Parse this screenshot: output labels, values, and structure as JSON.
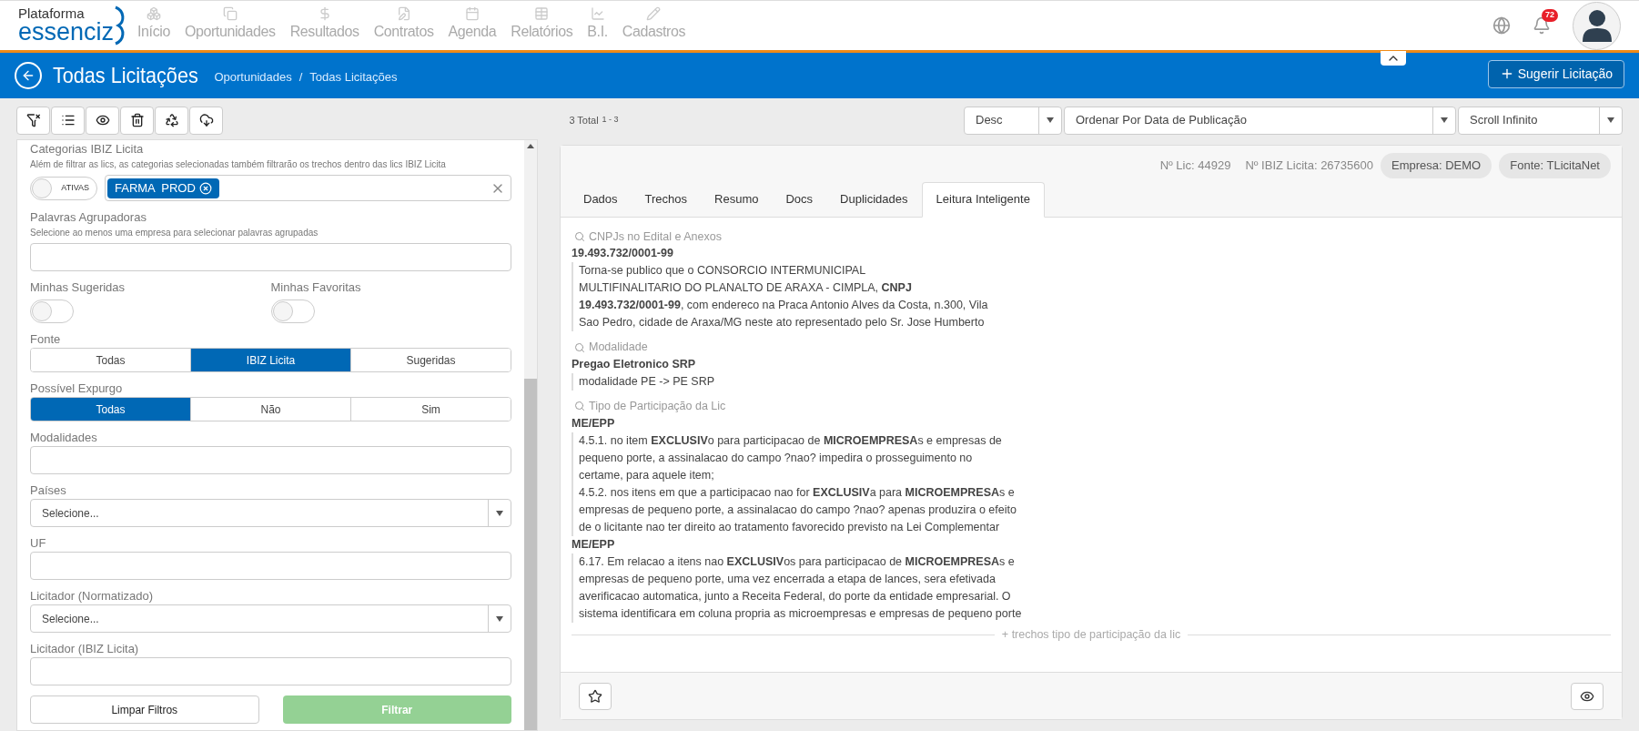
{
  "brand": {
    "line1": "Plataforma",
    "line2": "essenciz"
  },
  "nav": [
    {
      "label": "Início"
    },
    {
      "label": "Oportunidades"
    },
    {
      "label": "Resultados"
    },
    {
      "label": "Contratos"
    },
    {
      "label": "Agenda"
    },
    {
      "label": "Relatórios"
    },
    {
      "label": "B.I."
    },
    {
      "label": "Cadastros"
    }
  ],
  "notifications": {
    "count": "72"
  },
  "page": {
    "title": "Todas Licitações",
    "breadcrumb": [
      "Oportunidades",
      "Todas Licitações"
    ],
    "breadcrumb_separator": "/",
    "action": "Sugerir Licitação"
  },
  "toolbar": {
    "total": "3 Total",
    "range": "1 - 3",
    "order": "Desc",
    "sort": "Ordenar Por Data de Publicação",
    "mode": "Scroll Infinito"
  },
  "filters": [
    {
      "kind": "chips",
      "label": "Categorias IBIZ Licita",
      "hint": "Além de filtrar as lics, as categorias selecionadas também filtrarão os trechos dentro das lics IBIZ Licita",
      "toggle_label": "ATIVAS",
      "on": false,
      "chips": [
        "FARMA  PROD"
      ]
    },
    {
      "kind": "text",
      "label": "Palavras Agrupadoras",
      "hint": "Selecione ao menos uma empresa para selecionar palavras agrupadas"
    },
    {
      "kind": "toggles",
      "items": [
        {
          "label": "Minhas Sugeridas",
          "on": false
        },
        {
          "label": "Minhas Favoritas",
          "on": false
        }
      ]
    },
    {
      "kind": "segmented",
      "label": "Fonte",
      "options": [
        {
          "label": "Todas",
          "selected": false
        },
        {
          "label": "IBIZ Licita",
          "selected": true
        },
        {
          "label": "Sugeridas",
          "selected": false
        }
      ]
    },
    {
      "kind": "segmented",
      "label": "Possível Expurgo",
      "options": [
        {
          "label": "Todas",
          "selected": true
        },
        {
          "label": "Não",
          "selected": false
        },
        {
          "label": "Sim",
          "selected": false
        }
      ]
    },
    {
      "kind": "text",
      "label": "Modalidades"
    },
    {
      "kind": "select",
      "label": "Países",
      "placeholder": "Selecione..."
    },
    {
      "kind": "text",
      "label": "UF"
    },
    {
      "kind": "select",
      "label": "Licitador (Normatizado)",
      "placeholder": "Selecione..."
    },
    {
      "kind": "text",
      "label": "Licitador (IBIZ Licita)"
    }
  ],
  "filter_buttons": {
    "clear": "Limpar Filtros",
    "apply": "Filtrar"
  },
  "detail": {
    "info": [
      "Nº Lic: 44929",
      "Nº IBIZ Licita: 26735600"
    ],
    "pills": [
      "Empresa: DEMO",
      "Fonte: TLicitaNet"
    ],
    "tabs": [
      {
        "label": "Dados",
        "selected": false
      },
      {
        "label": "Trechos",
        "selected": false
      },
      {
        "label": "Resumo",
        "selected": false
      },
      {
        "label": "Docs",
        "selected": false
      },
      {
        "label": "Duplicidades",
        "selected": false
      },
      {
        "label": "Leitura Inteligente",
        "selected": true
      }
    ],
    "sections": [
      {
        "title": "CNPJs no Edital e Anexos",
        "entries": [
          {
            "value": "19.493.732/0001-99",
            "lines": [
              "Torna-se publico que o CONSORCIO INTERMUNICIPAL",
              "MULTIFINALITARIO DO PLANALTO DE ARAXA - CIMPLA, **CNPJ**",
              "**19.493.732/0001-99**, com endereco na Praca Antonio Alves da Costa, n.300, Vila",
              "Sao Pedro, cidade de Araxa/MG neste ato representado pelo Sr. Jose Humberto"
            ]
          }
        ]
      },
      {
        "title": "Modalidade",
        "entries": [
          {
            "value": "Pregao Eletronico SRP",
            "lines": [
              "modalidade PE -> PE SRP"
            ]
          }
        ]
      },
      {
        "title": "Tipo de Participação da Lic",
        "entries": [
          {
            "value": "ME/EPP",
            "lines": [
              "4.5.1. no item **EXCLUSIV**o para participacao de **MICROEMPRESA**s e empresas de",
              "pequeno porte, a assinalacao do campo ?nao? impedira o prosseguimento no",
              "certame, para aquele item;",
              "4.5.2. nos itens em que a participacao nao for **EXCLUSIV**a para **MICROEMPRESA**s e",
              "empresas de pequeno porte, a assinalacao do campo ?nao? apenas produzira o efeito",
              "de o licitante nao ter direito ao tratamento favorecido previsto na Lei Complementar"
            ]
          },
          {
            "value": "ME/EPP",
            "lines": [
              "6.17. Em relacao a itens nao **EXCLUSIV**os para participacao de **MICROEMPRESA**s e",
              "empresas de pequeno porte, uma vez encerrada a etapa de lances, sera efetivada",
              "averificacao automatica, junto a Receita Federal, do porte da entidade empresarial. O",
              "sistema identificara em coluna propria as microempresas e empresas de pequeno porte"
            ]
          }
        ]
      }
    ],
    "more": "+ trechos tipo de participação da lic"
  }
}
